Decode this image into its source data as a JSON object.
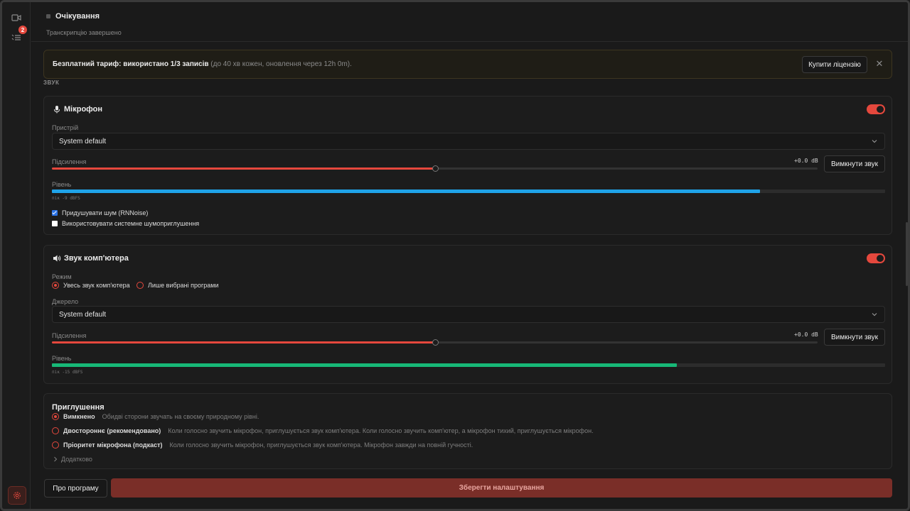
{
  "header": {
    "status_title": "Очікування",
    "status_subtitle": "Транскрипцію завершено"
  },
  "rail": {
    "badge_count": "2"
  },
  "banner": {
    "text_bold": "Безплатний тариф: використано 1/3 записів",
    "text_muted": " (до 40 хв кожен, оновлення через 12h 0m).",
    "buy_label": "Купити ліцензію",
    "close_glyph": "✕"
  },
  "section_label": "ЗВУК",
  "microphone": {
    "title": "Мікрофон",
    "enabled": true,
    "device_label": "Пристрій",
    "device_value": "System default",
    "gain_label": "Підсилення",
    "gain_value": "+0.0 dB",
    "gain_fraction": 0.5,
    "mute_label": "Вимкнути звук",
    "level_label": "Рівень",
    "level_fraction": 0.85,
    "level_color": "#1fa3e8",
    "peak": "пік -9 dBFS",
    "noise_suppress_label": "Придушувати шум (RNNoise)",
    "noise_suppress_checked": true,
    "system_noise_label": "Використовувати системне шумоприглушення",
    "system_noise_checked": false
  },
  "system_audio": {
    "title": "Звук комп'ютера",
    "enabled": true,
    "mode_label": "Режим",
    "mode_options": [
      "Увесь звук комп'ютера",
      "Лише вибрані програми"
    ],
    "mode_selected": 0,
    "source_label": "Джерело",
    "source_value": "System default",
    "gain_label": "Підсилення",
    "gain_value": "+0.0 dB",
    "gain_fraction": 0.5,
    "mute_label": "Вимкнути звук",
    "level_label": "Рівень",
    "level_fraction": 0.75,
    "level_color": "#17b877",
    "peak": "пік -15 dBFS"
  },
  "ducking": {
    "title": "Приглушення",
    "options": [
      {
        "label": "Вимкнено",
        "desc": "Обидві сторони звучать на своєму природному рівні."
      },
      {
        "label": "Двостороннє (рекомендовано)",
        "desc": "Коли голосно звучить мікрофон, приглушується звук комп'ютера. Коли голосно звучить комп'ютер, а мікрофон тихий, приглушується мікрофон."
      },
      {
        "label": "Пріоритет мікрофона (подкаст)",
        "desc": "Коли голосно звучить мікрофон, приглушується звук комп'ютера. Мікрофон завжди на повній гучності."
      }
    ],
    "selected": 0,
    "advanced_label": "Додатково"
  },
  "footer": {
    "about_label": "Про програму",
    "save_label": "Зберегти налаштування"
  },
  "colors": {
    "accent": "#e5483d",
    "save_bg": "#7a2e28"
  }
}
